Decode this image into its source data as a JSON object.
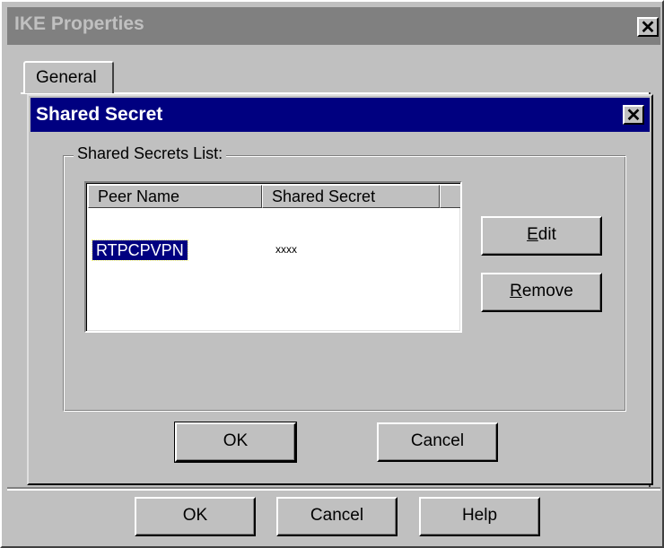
{
  "outer_window": {
    "title": "IKE Properties",
    "close_label": "✕",
    "tabs": [
      {
        "label": "General"
      }
    ],
    "buttons": {
      "ok": "OK",
      "cancel": "Cancel",
      "help": "Help"
    }
  },
  "dialog": {
    "title": "Shared Secret",
    "close_label": "✕",
    "group_label": "Shared Secrets List:",
    "list": {
      "columns": [
        "Peer Name",
        "Shared Secret"
      ],
      "rows": [
        {
          "peer_name": "RTPCPVPN",
          "shared_secret": "xxxx",
          "selected": true
        }
      ]
    },
    "side_buttons": {
      "edit_rest": "dit",
      "edit_mnemonic": "E",
      "remove_rest": "emove",
      "remove_mnemonic": "R"
    },
    "buttons": {
      "ok": "OK",
      "cancel": "Cancel"
    }
  },
  "colors": {
    "active_title": "#000080",
    "inactive_title": "#808080",
    "face": "#c0c0c0",
    "selection": "#000080"
  },
  "icons": {
    "close": "close-icon"
  }
}
